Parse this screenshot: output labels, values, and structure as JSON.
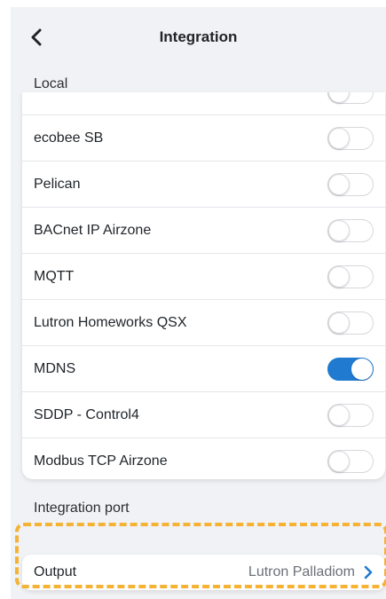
{
  "header": {
    "title": "Integration",
    "back_icon": "chevron-left-icon"
  },
  "sections": {
    "local": "Local",
    "integration_port": "Integration port"
  },
  "integrations": [
    {
      "label": "",
      "enabled": false
    },
    {
      "label": "ecobee SB",
      "enabled": false
    },
    {
      "label": "Pelican",
      "enabled": false
    },
    {
      "label": "BACnet IP Airzone",
      "enabled": false
    },
    {
      "label": "MQTT",
      "enabled": false
    },
    {
      "label": "Lutron Homeworks QSX",
      "enabled": false
    },
    {
      "label": "MDNS",
      "enabled": true
    },
    {
      "label": "SDDP - Control4",
      "enabled": false
    },
    {
      "label": "Modbus TCP Airzone",
      "enabled": false
    }
  ],
  "output": {
    "label": "Output",
    "value": "Lutron Palladiom",
    "icon": "chevron-right-icon"
  },
  "colors": {
    "accent": "#1f7ad0",
    "highlight": "#f5b233",
    "background": "#f0f2f5"
  }
}
